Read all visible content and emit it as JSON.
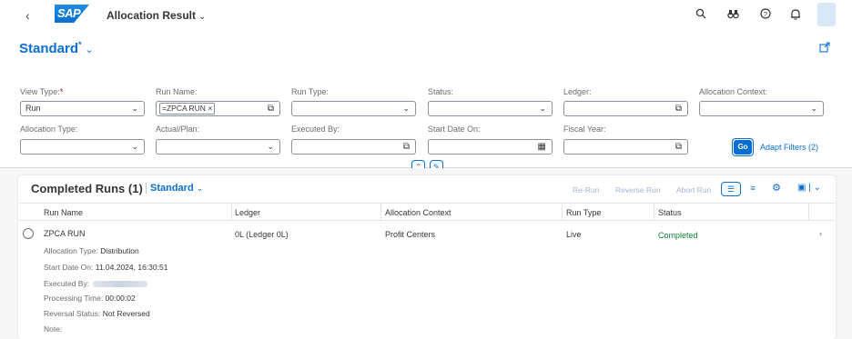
{
  "shell": {
    "title": "Allocation Result",
    "title_chevron": "⌄",
    "logo_text": "SAP",
    "icons": [
      "back-icon",
      "search-icon",
      "binoculars-icon",
      "help-icon",
      "bell-icon"
    ]
  },
  "variant": {
    "name": "Standard",
    "dirty_mark": "*",
    "chevron": "⌄"
  },
  "filters": {
    "view_type": {
      "label": "View Type:",
      "required": "*",
      "value": "Run"
    },
    "run_name": {
      "label": "Run Name:",
      "token": "=ZPCA RUN"
    },
    "run_type": {
      "label": "Run Type:",
      "value": ""
    },
    "status": {
      "label": "Status:",
      "value": ""
    },
    "ledger": {
      "label": "Ledger:",
      "value": ""
    },
    "allocation_context": {
      "label": "Allocation Context:",
      "value": ""
    },
    "allocation_type": {
      "label": "Allocation Type:",
      "value": ""
    },
    "actual_plan": {
      "label": "Actual/Plan:",
      "value": ""
    },
    "executed_by": {
      "label": "Executed By:",
      "value": ""
    },
    "start_date_on": {
      "label": "Start Date On:",
      "value": ""
    },
    "fiscal_year": {
      "label": "Fiscal Year:",
      "value": ""
    },
    "go_label": "Go",
    "adapt_label": "Adapt Filters (2)"
  },
  "table": {
    "title": "Completed Runs (1)",
    "variant": "Standard",
    "toolbar": {
      "rerun": "Re-Run",
      "reverse": "Reverse Run",
      "abort": "Abort Run"
    },
    "columns": [
      "Run Name",
      "Ledger",
      "Allocation Context",
      "Run Type",
      "Status"
    ],
    "rows": [
      {
        "run_name": "ZPCA RUN",
        "ledger": "0L (Ledger 0L)",
        "allocation_context": "Profit Centers",
        "run_type": "Live",
        "status": "Completed",
        "details": {
          "allocation_type_label": "Allocation Type:",
          "allocation_type": "Distribution",
          "start_date_label": "Start Date On:",
          "start_date": "11.04.2024, 16:30:51",
          "executed_by_label": "Executed By:",
          "processing_time_label": "Processing Time:",
          "processing_time": "00:00:02",
          "reversal_status_label": "Reversal Status:",
          "reversal_status": "Not Reversed",
          "note_label": "Note:"
        }
      }
    ]
  },
  "colors": {
    "accent": "#0a6ed1",
    "success": "#107e3e",
    "text": "#32363a"
  }
}
